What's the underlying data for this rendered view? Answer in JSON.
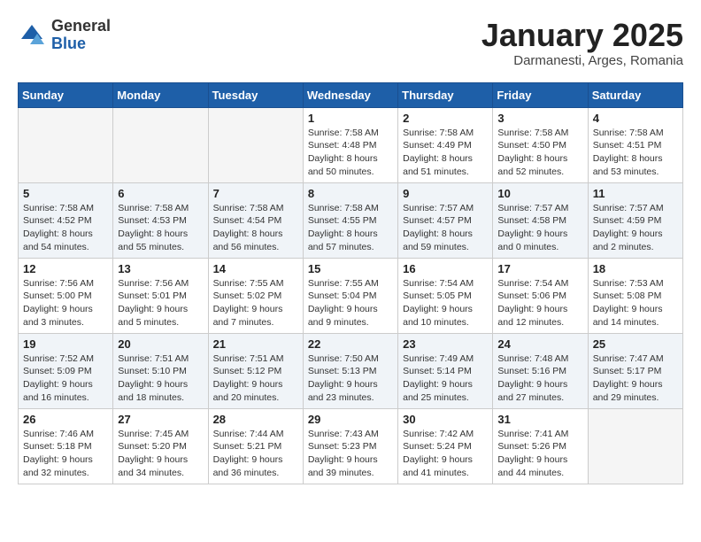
{
  "header": {
    "logo": {
      "general": "General",
      "blue": "Blue"
    },
    "title": "January 2025",
    "subtitle": "Darmanesti, Arges, Romania"
  },
  "weekdays": [
    "Sunday",
    "Monday",
    "Tuesday",
    "Wednesday",
    "Thursday",
    "Friday",
    "Saturday"
  ],
  "weeks": [
    [
      {
        "day": "",
        "info": ""
      },
      {
        "day": "",
        "info": ""
      },
      {
        "day": "",
        "info": ""
      },
      {
        "day": "1",
        "info": "Sunrise: 7:58 AM\nSunset: 4:48 PM\nDaylight: 8 hours\nand 50 minutes."
      },
      {
        "day": "2",
        "info": "Sunrise: 7:58 AM\nSunset: 4:49 PM\nDaylight: 8 hours\nand 51 minutes."
      },
      {
        "day": "3",
        "info": "Sunrise: 7:58 AM\nSunset: 4:50 PM\nDaylight: 8 hours\nand 52 minutes."
      },
      {
        "day": "4",
        "info": "Sunrise: 7:58 AM\nSunset: 4:51 PM\nDaylight: 8 hours\nand 53 minutes."
      }
    ],
    [
      {
        "day": "5",
        "info": "Sunrise: 7:58 AM\nSunset: 4:52 PM\nDaylight: 8 hours\nand 54 minutes."
      },
      {
        "day": "6",
        "info": "Sunrise: 7:58 AM\nSunset: 4:53 PM\nDaylight: 8 hours\nand 55 minutes."
      },
      {
        "day": "7",
        "info": "Sunrise: 7:58 AM\nSunset: 4:54 PM\nDaylight: 8 hours\nand 56 minutes."
      },
      {
        "day": "8",
        "info": "Sunrise: 7:58 AM\nSunset: 4:55 PM\nDaylight: 8 hours\nand 57 minutes."
      },
      {
        "day": "9",
        "info": "Sunrise: 7:57 AM\nSunset: 4:57 PM\nDaylight: 8 hours\nand 59 minutes."
      },
      {
        "day": "10",
        "info": "Sunrise: 7:57 AM\nSunset: 4:58 PM\nDaylight: 9 hours\nand 0 minutes."
      },
      {
        "day": "11",
        "info": "Sunrise: 7:57 AM\nSunset: 4:59 PM\nDaylight: 9 hours\nand 2 minutes."
      }
    ],
    [
      {
        "day": "12",
        "info": "Sunrise: 7:56 AM\nSunset: 5:00 PM\nDaylight: 9 hours\nand 3 minutes."
      },
      {
        "day": "13",
        "info": "Sunrise: 7:56 AM\nSunset: 5:01 PM\nDaylight: 9 hours\nand 5 minutes."
      },
      {
        "day": "14",
        "info": "Sunrise: 7:55 AM\nSunset: 5:02 PM\nDaylight: 9 hours\nand 7 minutes."
      },
      {
        "day": "15",
        "info": "Sunrise: 7:55 AM\nSunset: 5:04 PM\nDaylight: 9 hours\nand 9 minutes."
      },
      {
        "day": "16",
        "info": "Sunrise: 7:54 AM\nSunset: 5:05 PM\nDaylight: 9 hours\nand 10 minutes."
      },
      {
        "day": "17",
        "info": "Sunrise: 7:54 AM\nSunset: 5:06 PM\nDaylight: 9 hours\nand 12 minutes."
      },
      {
        "day": "18",
        "info": "Sunrise: 7:53 AM\nSunset: 5:08 PM\nDaylight: 9 hours\nand 14 minutes."
      }
    ],
    [
      {
        "day": "19",
        "info": "Sunrise: 7:52 AM\nSunset: 5:09 PM\nDaylight: 9 hours\nand 16 minutes."
      },
      {
        "day": "20",
        "info": "Sunrise: 7:51 AM\nSunset: 5:10 PM\nDaylight: 9 hours\nand 18 minutes."
      },
      {
        "day": "21",
        "info": "Sunrise: 7:51 AM\nSunset: 5:12 PM\nDaylight: 9 hours\nand 20 minutes."
      },
      {
        "day": "22",
        "info": "Sunrise: 7:50 AM\nSunset: 5:13 PM\nDaylight: 9 hours\nand 23 minutes."
      },
      {
        "day": "23",
        "info": "Sunrise: 7:49 AM\nSunset: 5:14 PM\nDaylight: 9 hours\nand 25 minutes."
      },
      {
        "day": "24",
        "info": "Sunrise: 7:48 AM\nSunset: 5:16 PM\nDaylight: 9 hours\nand 27 minutes."
      },
      {
        "day": "25",
        "info": "Sunrise: 7:47 AM\nSunset: 5:17 PM\nDaylight: 9 hours\nand 29 minutes."
      }
    ],
    [
      {
        "day": "26",
        "info": "Sunrise: 7:46 AM\nSunset: 5:18 PM\nDaylight: 9 hours\nand 32 minutes."
      },
      {
        "day": "27",
        "info": "Sunrise: 7:45 AM\nSunset: 5:20 PM\nDaylight: 9 hours\nand 34 minutes."
      },
      {
        "day": "28",
        "info": "Sunrise: 7:44 AM\nSunset: 5:21 PM\nDaylight: 9 hours\nand 36 minutes."
      },
      {
        "day": "29",
        "info": "Sunrise: 7:43 AM\nSunset: 5:23 PM\nDaylight: 9 hours\nand 39 minutes."
      },
      {
        "day": "30",
        "info": "Sunrise: 7:42 AM\nSunset: 5:24 PM\nDaylight: 9 hours\nand 41 minutes."
      },
      {
        "day": "31",
        "info": "Sunrise: 7:41 AM\nSunset: 5:26 PM\nDaylight: 9 hours\nand 44 minutes."
      },
      {
        "day": "",
        "info": ""
      }
    ]
  ]
}
